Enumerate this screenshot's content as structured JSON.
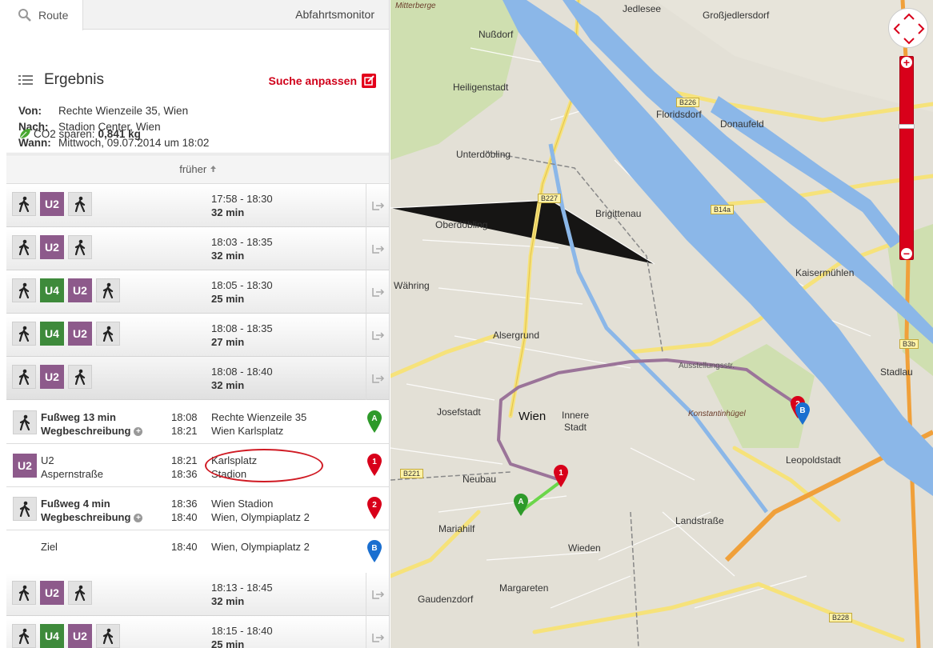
{
  "tabs": {
    "route": "Route",
    "monitor": "Abfahrtsmonitor"
  },
  "result": {
    "title": "Ergebnis",
    "adjust_label": "Suche anpassen",
    "from_label": "Von:",
    "from": "Rechte Wienzeile 35, Wien",
    "to_label": "Nach:",
    "to": "Stadion Center, Wien",
    "when_label": "Wann:",
    "when": "Mittwoch, 09.07.2014 um 18:02",
    "co2_label": "CO2 sparen:",
    "co2_value": "0,841 kg",
    "earlier_label": "früher"
  },
  "connections": [
    {
      "lines": [
        "walk",
        "U2",
        "walk"
      ],
      "time": "17:58 - 18:30",
      "duration": "32 min"
    },
    {
      "lines": [
        "walk",
        "U2",
        "walk"
      ],
      "time": "18:03 - 18:35",
      "duration": "32 min"
    },
    {
      "lines": [
        "walk",
        "U4",
        "U2",
        "walk"
      ],
      "time": "18:05 - 18:30",
      "duration": "25 min"
    },
    {
      "lines": [
        "walk",
        "U4",
        "U2",
        "walk"
      ],
      "time": "18:08 - 18:35",
      "duration": "27 min"
    },
    {
      "lines": [
        "walk",
        "U2",
        "walk"
      ],
      "time": "18:08 - 18:40",
      "duration": "32 min"
    },
    {
      "lines": [
        "walk",
        "U2",
        "walk"
      ],
      "time": "18:13 - 18:45",
      "duration": "32 min"
    },
    {
      "lines": [
        "walk",
        "U4",
        "U2",
        "walk"
      ],
      "time": "18:15 - 18:40",
      "duration": "25 min"
    }
  ],
  "details": [
    {
      "mode": "walk",
      "line1": "Fußweg 13 min",
      "line2": "Wegbeschreibung",
      "t1": "18:08",
      "t2": "18:21",
      "p1": "Rechte Wienzeile 35",
      "p2": "Wien Karlsplatz",
      "marker": "A",
      "marker_color": "#2e9a2a"
    },
    {
      "mode": "U2",
      "line1": "U2",
      "line2": "Aspernstraße",
      "t1": "18:21",
      "t2": "18:36",
      "p1": "Karlsplatz",
      "p2": "Stadion",
      "marker": "1",
      "marker_color": "#d8001a"
    },
    {
      "mode": "walk",
      "line1": "Fußweg 4 min",
      "line2": "Wegbeschreibung",
      "t1": "18:36",
      "t2": "18:40",
      "p1": "Wien Stadion",
      "p2": "Wien, Olympiaplatz 2",
      "marker": "2",
      "marker_color": "#d8001a"
    },
    {
      "mode": "none",
      "line1": "Ziel",
      "line2": "",
      "t1": "18:40",
      "t2": "",
      "p1": "Wien, Olympiaplatz 2",
      "p2": "",
      "marker": "B",
      "marker_color": "#1a6fd0"
    }
  ],
  "map": {
    "labels": {
      "mitterberge": "Mitterberge",
      "jedlesee": "Jedlesee",
      "grossjedlersdorf": "Großjedlersdorf",
      "nussdorf": "Nußdorf",
      "heiligenstadt": "Heiligenstadt",
      "floridsdorf": "Floridsdorf",
      "donaufeld": "Donaufeld",
      "unterdoebling": "Unterdöbling",
      "brigittenau": "Brigittenau",
      "oberdoebling": "Oberdöbling",
      "kaisermuehlen": "Kaisermühlen",
      "waehring": "Währing",
      "alsergrund": "Alsergrund",
      "stadlau": "Stadlau",
      "josefstadt": "Josefstadt",
      "wien": "Wien",
      "innere_stadt": "Innere\nStadt",
      "leopoldstadt": "Leopoldstadt",
      "neubau": "Neubau",
      "mariahilf": "Mariahilf",
      "landstrasse": "Landstraße",
      "wieden": "Wieden",
      "margareten": "Margareten",
      "gaudenzdorf": "Gaudenzdorf",
      "konstantinhuegel": "Konstantinhügel",
      "ausstellungsstr": "Ausstellungsstr."
    },
    "roads": [
      "B226",
      "B227",
      "B14a",
      "B221",
      "B3b",
      "B228"
    ],
    "markers": {
      "a": "A",
      "one": "1",
      "two": "2",
      "b": "B"
    },
    "colors": {
      "route_u2": "#9b7499",
      "route_walk": "#6bd64a",
      "danube": "#8bb7e8",
      "accent": "#d8001a"
    }
  }
}
